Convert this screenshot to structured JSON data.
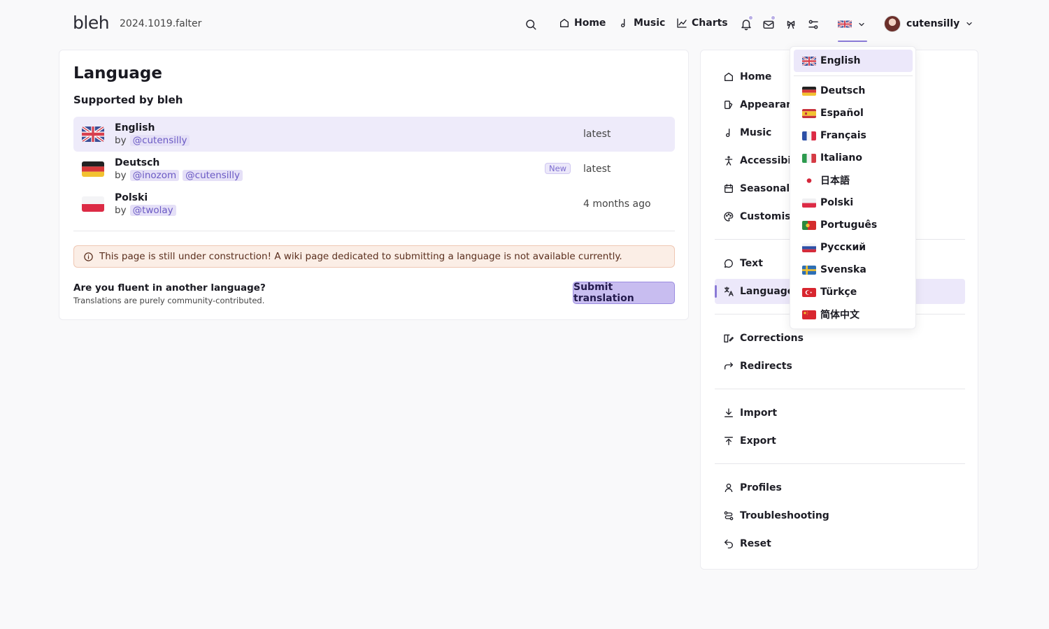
{
  "header": {
    "logo": "bleh",
    "version": "2024.1019.falter",
    "nav": [
      {
        "label": "Home",
        "icon": "home-icon"
      },
      {
        "label": "Music",
        "icon": "music-note-icon"
      },
      {
        "label": "Charts",
        "icon": "chart-line-icon"
      }
    ],
    "username": "cutensilly",
    "current_language_flag": "uk-flag"
  },
  "language_page": {
    "title": "Language",
    "section_title": "Supported by bleh",
    "languages": [
      {
        "name": "English",
        "by_label": "by",
        "contributors": [
          "@cutensilly"
        ],
        "status": "latest",
        "badge": ""
      },
      {
        "name": "Deutsch",
        "by_label": "by",
        "contributors": [
          "@inozom",
          "@cutensilly"
        ],
        "status": "latest",
        "badge": "New"
      },
      {
        "name": "Polski",
        "by_label": "by",
        "contributors": [
          "@twolay"
        ],
        "status": "4 months ago",
        "badge": ""
      }
    ],
    "notice": "This page is still under construction! A wiki page dedicated to submitting a language is not available currently.",
    "fluent_question": "Are you fluent in another language?",
    "fluent_sub": "Translations are purely community-contributed.",
    "submit_button": "Submit translation"
  },
  "settings_nav": {
    "items": [
      {
        "label": "Home",
        "icon": "home-icon"
      },
      {
        "label": "Appearance",
        "icon": "palette-brush-icon"
      },
      {
        "label": "Music",
        "icon": "music-note-icon"
      },
      {
        "label": "Accessibility",
        "icon": "accessibility-icon"
      },
      {
        "label": "Seasonal",
        "icon": "calendar-icon"
      },
      {
        "label": "Customise",
        "icon": "palette-icon"
      },
      {
        "label": "Text",
        "icon": "speech-bubble-icon"
      },
      {
        "label": "Language",
        "icon": "translate-icon"
      },
      {
        "label": "Corrections",
        "icon": "book-edit-icon"
      },
      {
        "label": "Redirects",
        "icon": "redirect-arrow-icon"
      },
      {
        "label": "Import",
        "icon": "download-icon"
      },
      {
        "label": "Export",
        "icon": "upload-icon"
      },
      {
        "label": "Profiles",
        "icon": "user-icon"
      },
      {
        "label": "Troubleshooting",
        "icon": "route-icon"
      },
      {
        "label": "Reset",
        "icon": "undo-icon"
      }
    ],
    "active": "Language"
  },
  "language_dropdown": {
    "selected": "English",
    "options": [
      {
        "label": "English",
        "flag": "uk"
      },
      {
        "label": "Deutsch",
        "flag": "de"
      },
      {
        "label": "Español",
        "flag": "es"
      },
      {
        "label": "Français",
        "flag": "fr"
      },
      {
        "label": "Italiano",
        "flag": "it"
      },
      {
        "label": "日本語",
        "flag": "jp"
      },
      {
        "label": "Polski",
        "flag": "pl"
      },
      {
        "label": "Português",
        "flag": "pt"
      },
      {
        "label": "Русский",
        "flag": "ru"
      },
      {
        "label": "Svenska",
        "flag": "se"
      },
      {
        "label": "Türkçe",
        "flag": "tr"
      },
      {
        "label": "简体中文",
        "flag": "cn"
      }
    ]
  },
  "colors": {
    "accent": "#8a7ad6",
    "accent_bg": "#ece8fa",
    "notice_bg": "#fbeee6",
    "notice_border": "#efc7b3"
  }
}
